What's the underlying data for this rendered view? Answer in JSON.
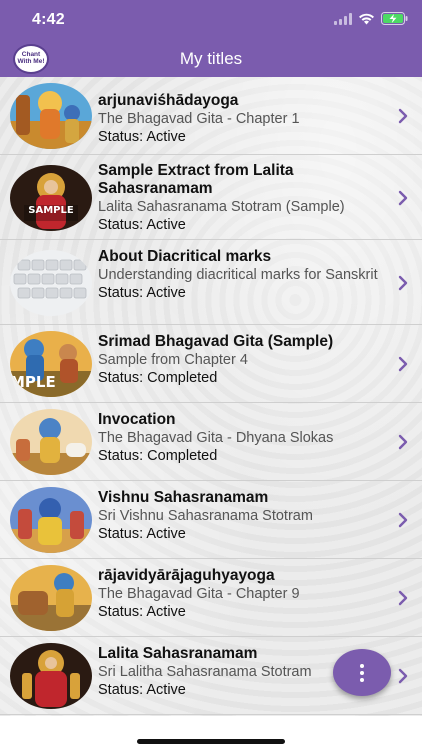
{
  "status_bar": {
    "time": "4:42"
  },
  "header": {
    "logo_text": "Chant With Me!",
    "title": "My titles"
  },
  "items": [
    {
      "title": "arjunaviśhādayoga",
      "subtitle": "The Bhagavad Gita - Chapter 1",
      "status": "Status: Active"
    },
    {
      "title": "Sample Extract from Lalita Sahasranamam",
      "subtitle": "Lalita Sahasranama Stotram (Sample)",
      "status": "Status: Active",
      "thumb_text": "SAMPLE"
    },
    {
      "title": "About Diacritical marks",
      "subtitle": "Understanding diacritical marks for Sanskrit",
      "status": "Status: Active"
    },
    {
      "title": "Srimad Bhagavad Gita (Sample)",
      "subtitle": "Sample from Chapter 4",
      "status": "Status: Completed",
      "thumb_text": "MPLE"
    },
    {
      "title": "Invocation",
      "subtitle": "The Bhagavad Gita - Dhyana Slokas",
      "status": "Status: Completed"
    },
    {
      "title": "Vishnu Sahasranamam",
      "subtitle": "Sri Vishnu Sahasranama Stotram",
      "status": "Status: Active"
    },
    {
      "title": "rājavidyārājaguhyayoga",
      "subtitle": "The Bhagavad Gita - Chapter 9",
      "status": "Status: Active"
    },
    {
      "title": "Lalita Sahasranamam",
      "subtitle": "Sri Lalitha Sahasranama Stotram",
      "status": "Status: Active"
    }
  ],
  "colors": {
    "accent": "#7b5cae",
    "chevron": "#7b5cae"
  }
}
